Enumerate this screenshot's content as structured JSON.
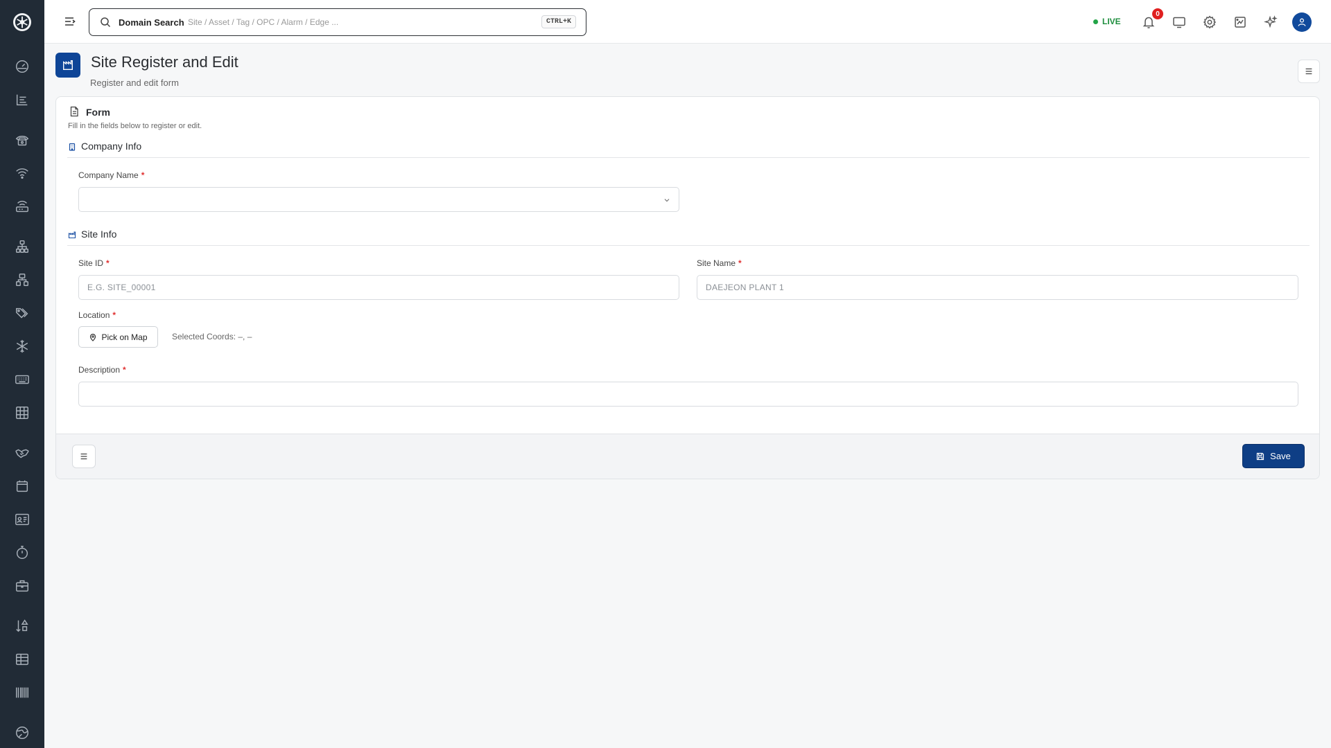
{
  "topbar": {
    "search_label": "Domain Search",
    "search_placeholder": "Site / Asset / Tag / OPC / Alarm / Edge ...",
    "shortcut": "CTRL+K",
    "live_label": "LIVE",
    "notification_count": "0"
  },
  "page": {
    "title": "Site Register and Edit",
    "subtitle": "Register and edit form"
  },
  "form": {
    "title": "Form",
    "description": "Fill in the fields below to register or edit.",
    "company_section": "Company Info",
    "site_section": "Site Info",
    "company_name_label": "Company Name",
    "company_name_value": "",
    "site_id_label": "Site ID",
    "site_id_placeholder": "E.G. SITE_00001",
    "site_name_label": "Site Name",
    "site_name_placeholder": "DAEJEON PLANT 1",
    "location_label": "Location",
    "pick_on_map_label": "Pick on Map",
    "selected_coords": "Selected Coords: –, –",
    "description_label": "Description",
    "description_value": "",
    "required_mark": "*"
  },
  "footer": {
    "save_label": "Save"
  },
  "colors": {
    "sidebar": "#212b36",
    "primary": "#0e3e85",
    "live": "#1e8e3e",
    "required": "#e03030"
  }
}
